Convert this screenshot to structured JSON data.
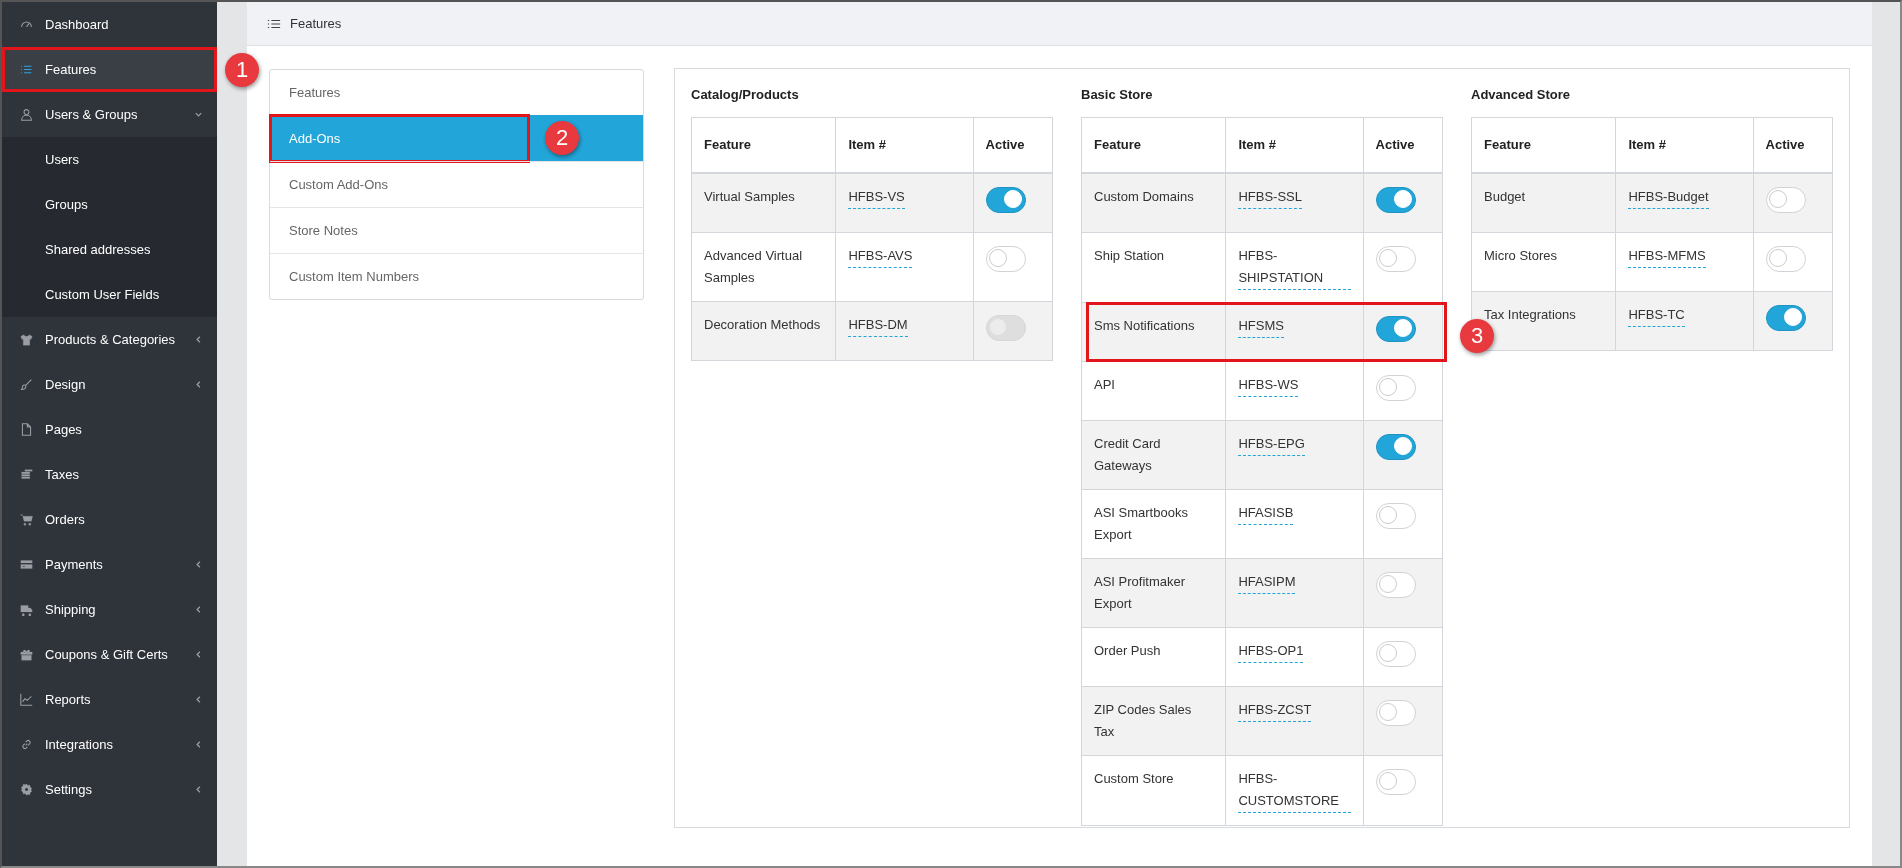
{
  "sidebar": {
    "items": [
      {
        "label": "Dashboard",
        "selected": false
      },
      {
        "label": "Features",
        "selected": true,
        "callout": "1"
      },
      {
        "label": "Users & Groups",
        "selected": false,
        "expanded": true,
        "children": [
          {
            "label": "Users",
            "selected": false
          },
          {
            "label": "Groups",
            "selected": false
          },
          {
            "label": "Shared addresses",
            "selected": false
          },
          {
            "label": "Custom User Fields",
            "selected": false
          }
        ]
      },
      {
        "label": "Products & Categories",
        "selected": false,
        "expanded": false
      },
      {
        "label": "Design",
        "selected": false,
        "expanded": false
      },
      {
        "label": "Pages",
        "selected": false
      },
      {
        "label": "Taxes",
        "selected": false
      },
      {
        "label": "Orders",
        "selected": false
      },
      {
        "label": "Payments",
        "selected": false,
        "expanded": false
      },
      {
        "label": "Shipping",
        "selected": false,
        "expanded": false
      },
      {
        "label": "Coupons & Gift Certs",
        "selected": false,
        "expanded": false
      },
      {
        "label": "Reports",
        "selected": false,
        "expanded": false
      },
      {
        "label": "Integrations",
        "selected": false,
        "expanded": false
      },
      {
        "label": "Settings",
        "selected": false,
        "expanded": false
      }
    ]
  },
  "header": {
    "title": "Features"
  },
  "feature_menu": {
    "items": [
      {
        "label": "Features",
        "selected": false
      },
      {
        "label": "Add-Ons",
        "selected": true,
        "callout": "2"
      },
      {
        "label": "Custom Add-Ons",
        "selected": false
      },
      {
        "label": "Store Notes",
        "selected": false
      },
      {
        "label": "Custom Item Numbers",
        "selected": false
      }
    ]
  },
  "sections": [
    {
      "title": "Catalog/Products",
      "columns": [
        "Feature",
        "Item #",
        "Active"
      ],
      "rows": [
        {
          "feature": "Virtual Samples",
          "item": "HFBS-VS",
          "active": true,
          "disabled": false
        },
        {
          "feature": "Advanced Virtual Samples",
          "item": "HFBS-AVS",
          "active": false,
          "disabled": false
        },
        {
          "feature": "Decoration Methods",
          "item": "HFBS-DM",
          "active": false,
          "disabled": true
        }
      ]
    },
    {
      "title": "Basic Store",
      "columns": [
        "Feature",
        "Item #",
        "Active"
      ],
      "rows": [
        {
          "feature": "Custom Domains",
          "item": "HFBS-SSL",
          "active": true,
          "disabled": false
        },
        {
          "feature": "Ship Station",
          "item": "HFBS-SHIPSTATION",
          "active": false,
          "disabled": false
        },
        {
          "feature": "Sms Notifications",
          "item": "HFSMS",
          "active": true,
          "disabled": false,
          "callout": "3"
        },
        {
          "feature": "API",
          "item": "HFBS-WS",
          "active": false,
          "disabled": false
        },
        {
          "feature": "Credit Card Gateways",
          "item": "HFBS-EPG",
          "active": true,
          "disabled": false
        },
        {
          "feature": "ASI Smartbooks Export",
          "item": "HFASISB",
          "active": false,
          "disabled": false
        },
        {
          "feature": "ASI Profitmaker Export",
          "item": "HFASIPM",
          "active": false,
          "disabled": false
        },
        {
          "feature": "Order Push",
          "item": "HFBS-OP1",
          "active": false,
          "disabled": false
        },
        {
          "feature": "ZIP Codes Sales Tax",
          "item": "HFBS-ZCST",
          "active": false,
          "disabled": false
        },
        {
          "feature": "Custom Store",
          "item": "HFBS-CUSTOMSTORE",
          "active": false,
          "disabled": false
        }
      ]
    },
    {
      "title": "Advanced Store",
      "columns": [
        "Feature",
        "Item #",
        "Active"
      ],
      "rows": [
        {
          "feature": "Budget",
          "item": "HFBS-Budget",
          "active": false,
          "disabled": false
        },
        {
          "feature": "Micro Stores",
          "item": "HFBS-MFMS",
          "active": false,
          "disabled": false
        },
        {
          "feature": "Tax Integrations",
          "item": "HFBS-TC",
          "active": true,
          "disabled": false
        }
      ]
    }
  ]
}
